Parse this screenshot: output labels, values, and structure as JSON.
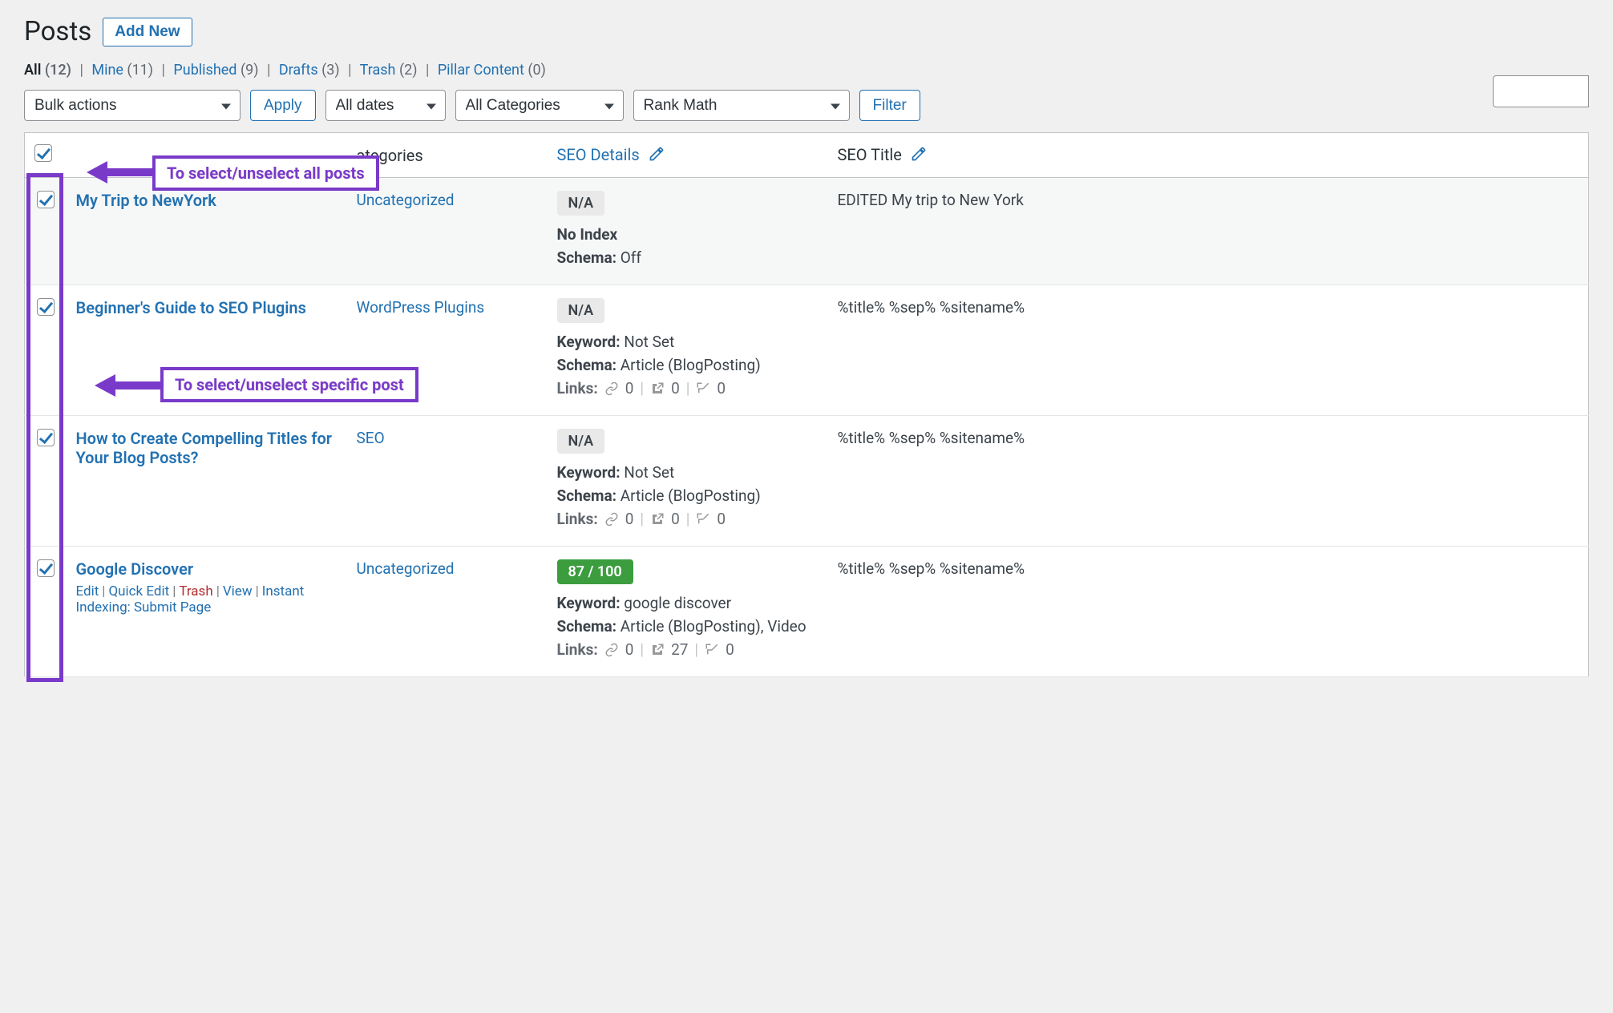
{
  "page": {
    "title": "Posts",
    "add_new": "Add New"
  },
  "search": {
    "placeholder": ""
  },
  "filters": {
    "all_label": "All",
    "all_count": "(12)",
    "mine_label": "Mine",
    "mine_count": "(11)",
    "published_label": "Published",
    "published_count": "(9)",
    "drafts_label": "Drafts",
    "drafts_count": "(3)",
    "trash_label": "Trash",
    "trash_count": "(2)",
    "pillar_label": "Pillar Content",
    "pillar_count": "(0)"
  },
  "controls": {
    "bulk_actions": "Bulk actions",
    "apply": "Apply",
    "all_dates": "All dates",
    "all_categories": "All Categories",
    "rank_math": "Rank Math",
    "filter": "Filter"
  },
  "columns": {
    "categories": "ategories",
    "seo_details": "SEO Details",
    "seo_title": "SEO Title"
  },
  "annotations": {
    "select_all": "To select/unselect all posts",
    "select_one": "To select/unselect specific post"
  },
  "labels": {
    "keyword": "Keyword:",
    "schema": "Schema:",
    "links": "Links:",
    "no_index": "No Index"
  },
  "row_actions": {
    "edit": "Edit",
    "quick_edit": "Quick Edit",
    "trash": "Trash",
    "view": "View",
    "instant_indexing": "Instant Indexing: Submit Page"
  },
  "rows": [
    {
      "title": "My Trip to NewYork",
      "category": "Uncategorized",
      "score": "N/A",
      "no_index": true,
      "schema": "Off",
      "seo_title": "EDITED My trip to New York",
      "show_keyword": false,
      "show_links": false,
      "show_actions": false,
      "alt": true
    },
    {
      "title": "Beginner's Guide to SEO Plugins",
      "category": "WordPress Plugins",
      "score": "N/A",
      "keyword": "Not Set",
      "schema": "Article (BlogPosting)",
      "links": {
        "internal": "0",
        "external": "0",
        "incoming": "0"
      },
      "seo_title": "%title% %sep% %sitename%",
      "show_keyword": true,
      "show_links": true,
      "show_actions": false,
      "alt": false
    },
    {
      "title": "How to Create Compelling Titles for Your Blog Posts?",
      "category": "SEO",
      "score": "N/A",
      "keyword": "Not Set",
      "schema": "Article (BlogPosting)",
      "links": {
        "internal": "0",
        "external": "0",
        "incoming": "0"
      },
      "seo_title": "%title% %sep% %sitename%",
      "show_keyword": true,
      "show_links": true,
      "show_actions": false,
      "alt": false
    },
    {
      "title": "Google Discover",
      "category": "Uncategorized",
      "score": "87 / 100",
      "score_good": true,
      "keyword": "google discover",
      "schema": "Article (BlogPosting), Video",
      "links": {
        "internal": "0",
        "external": "27",
        "incoming": "0"
      },
      "seo_title": "%title% %sep% %sitename%",
      "show_keyword": true,
      "show_links": true,
      "show_actions": true,
      "alt": false
    }
  ]
}
